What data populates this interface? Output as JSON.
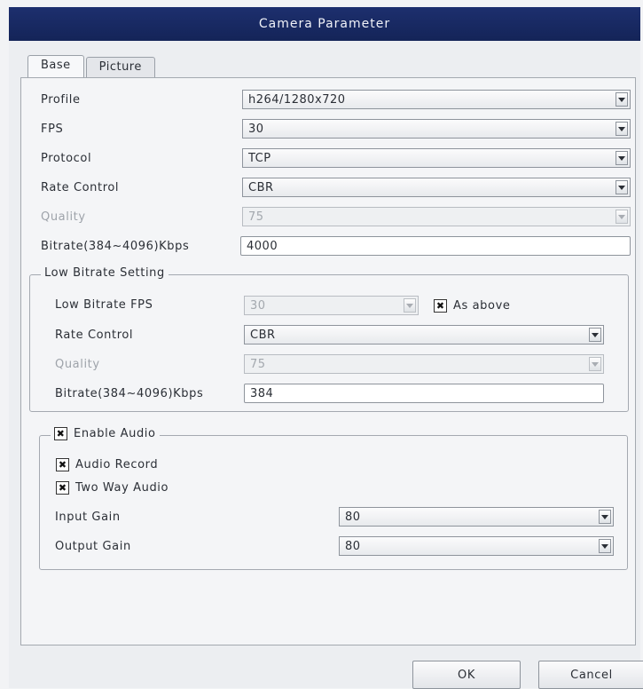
{
  "window": {
    "title": "Camera Parameter"
  },
  "tabs": [
    {
      "label": "Base",
      "active": true
    },
    {
      "label": "Picture",
      "active": false
    }
  ],
  "base": {
    "profile": {
      "label": "Profile",
      "value": "h264/1280x720"
    },
    "fps": {
      "label": "FPS",
      "value": "30"
    },
    "protocol": {
      "label": "Protocol",
      "value": "TCP"
    },
    "rate_control": {
      "label": "Rate Control",
      "value": "CBR"
    },
    "quality": {
      "label": "Quality",
      "value": "75",
      "disabled": true
    },
    "bitrate": {
      "label": "Bitrate(384~4096)Kbps",
      "value": "4000"
    }
  },
  "low_bitrate": {
    "legend": "Low Bitrate Setting",
    "fps": {
      "label": "Low Bitrate FPS",
      "value": "30",
      "disabled": true
    },
    "as_above": {
      "label": "As above",
      "checked": true
    },
    "rate_control": {
      "label": "Rate Control",
      "value": "CBR"
    },
    "quality": {
      "label": "Quality",
      "value": "75",
      "disabled": true
    },
    "bitrate": {
      "label": "Bitrate(384~4096)Kbps",
      "value": "384"
    }
  },
  "audio": {
    "enable": {
      "label": "Enable Audio",
      "checked": true
    },
    "record": {
      "label": "Audio Record",
      "checked": true
    },
    "two_way": {
      "label": "Two Way Audio",
      "checked": true
    },
    "input_gain": {
      "label": "Input Gain",
      "value": "80"
    },
    "output_gain": {
      "label": "Output Gain",
      "value": "80"
    }
  },
  "buttons": {
    "ok": "OK",
    "cancel": "Cancel"
  },
  "icons": {
    "checkbox_mark": "✖",
    "dropdown": "chevron-down-icon"
  }
}
